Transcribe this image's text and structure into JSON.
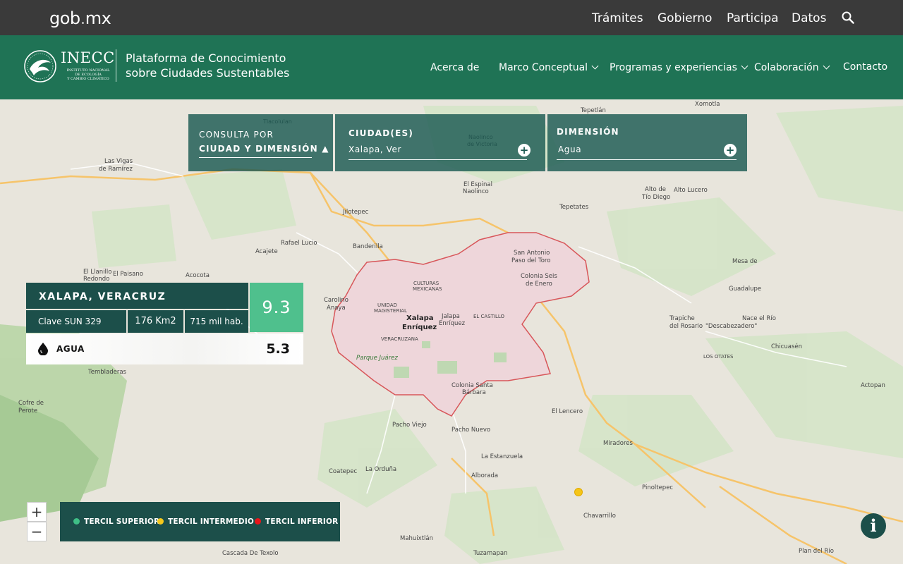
{
  "topbar": {
    "logo_text": "gob",
    "logo_dot": ".",
    "logo_suffix": "mx",
    "nav": [
      "Trámites",
      "Gobierno",
      "Participa",
      "Datos"
    ],
    "search_icon": "search-icon"
  },
  "header": {
    "brand_name": "INECC",
    "brand_sub_lines": [
      "INSTITUTO NACIONAL",
      "DE ECOLOGÍA",
      "Y CAMBIO CLIMÁTICO"
    ],
    "title_line1": "Plataforma de Conocimiento",
    "title_line2": "sobre Ciudades Sustentables",
    "nav": [
      {
        "label": "Acerca de",
        "dropdown": false
      },
      {
        "label": "Marco Conceptual",
        "dropdown": true
      },
      {
        "label": "Programas y experiencias",
        "dropdown": true
      },
      {
        "label": "Colaboración",
        "dropdown": true
      },
      {
        "label": "Contacto",
        "dropdown": false
      }
    ]
  },
  "query": {
    "label": "CONSULTA POR",
    "mode": "CIUDAD Y DIMENSIÓN ▲",
    "city_label": "CIUDAD(ES)",
    "city_value": "Xalapa, Ver",
    "dimension_label": "DIMENSIÓN",
    "dimension_value": "Agua"
  },
  "city_card": {
    "name": "XALAPA, VERACRUZ",
    "score": "9.3",
    "clave": "Clave SUN 329",
    "area": "176 Km2",
    "population": "715 mil hab.",
    "dimension_icon": "water-drop-icon",
    "dimension_label": "AGUA",
    "dimension_value": "5.3"
  },
  "map": {
    "labels": [
      "Tlacolulan",
      "Las Vigas de Ramírez",
      "Tepetlán",
      "Xomotla",
      "Alto de Tío Diego",
      "Alto Lucero",
      "Tepetates",
      "El Espinal Naolinco",
      "Naolinco de Victoria",
      "Jilotepec",
      "Banderilla",
      "Rafael Lucio",
      "Acajete",
      "El Llanillo Redondo",
      "El Paisano",
      "Acocota",
      "San Antonio Paso del Toro",
      "Colonia Seis de Enero",
      "Mesa de Guadalupe",
      "Carolino Anaya",
      "Culturas Mexicanas",
      "Unidad Magisterial",
      "Xalapa Enríquez",
      "Jalapa Enríquez",
      "El Castillo",
      "Trapiche del Rosario",
      "Nace el Río \"Descabezadero\"",
      "Chicuasén",
      "Veracruzana",
      "Parque Juárez",
      "Los Otates",
      "Actopan",
      "Tembladeras",
      "Colonia Santa Bárbara",
      "El Lencero",
      "Cofre de Perote",
      "Pacho Viejo",
      "Pacho Nuevo",
      "Miradores",
      "Coatepec",
      "La Orduña",
      "La Estanzuela",
      "Alborada",
      "Pinoltepec",
      "Chavarrillo",
      "Mahuixtlán",
      "Tuzamapan",
      "Cascada De Texolo",
      "Plan del Río"
    ],
    "marker_color": "#f5c518"
  },
  "zoom": {
    "in": "+",
    "out": "−"
  },
  "legend": [
    {
      "label": "TERCIL SUPERIOR",
      "color": "#3fbf86"
    },
    {
      "label": "TERCIL INTERMEDIO",
      "color": "#f4c81c"
    },
    {
      "label": "TERCIL INFERIOR",
      "color": "#e8151b"
    }
  ],
  "info_button": "i",
  "colors": {
    "topbar": "#3a3a3a",
    "header": "#1f7355",
    "panel": "#1c4f4a",
    "score": "#4fc08d"
  }
}
